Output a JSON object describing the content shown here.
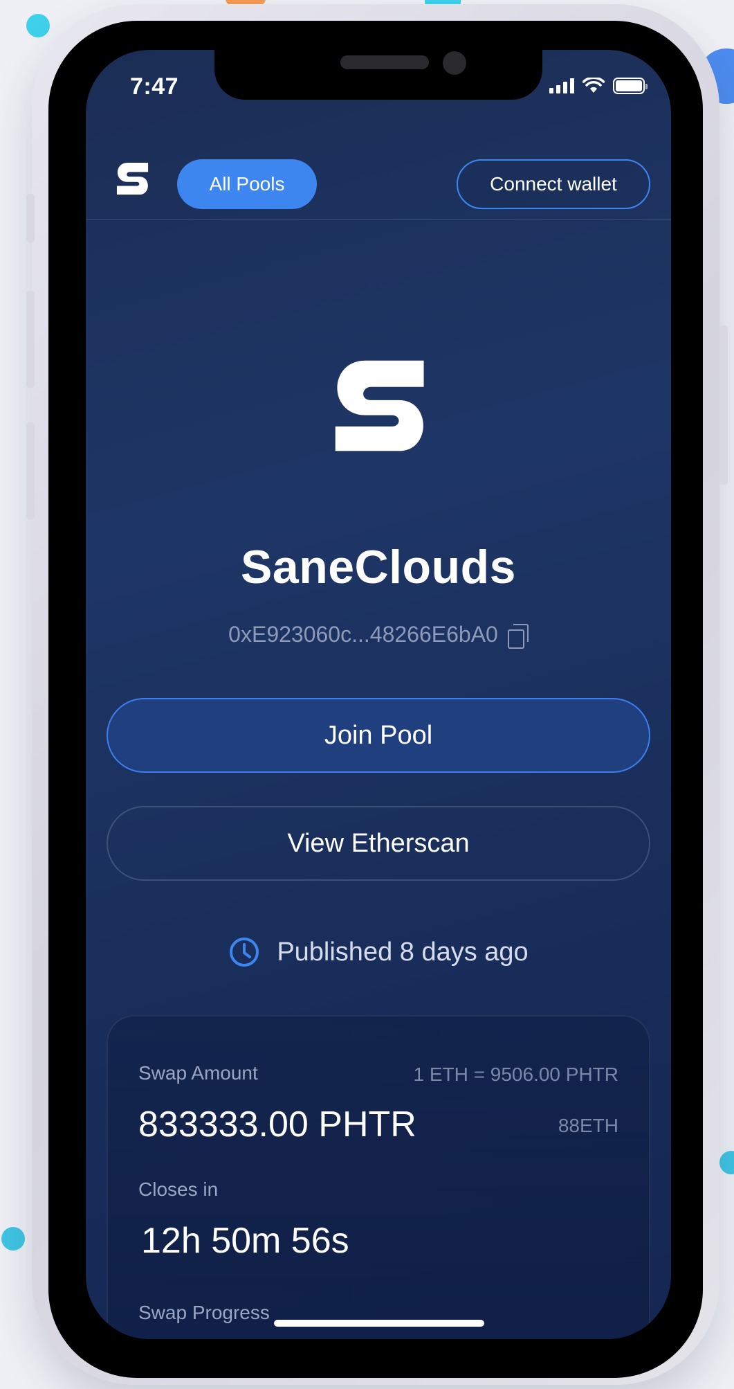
{
  "status_bar": {
    "time": "7:47"
  },
  "header": {
    "all_pools_label": "All Pools",
    "connect_wallet_label": "Connect wallet"
  },
  "pool": {
    "name": "SaneClouds",
    "address": "0xE923060c...48266E6bA0",
    "join_label": "Join Pool",
    "etherscan_label": "View Etherscan",
    "published": "Published 8 days ago"
  },
  "card": {
    "swap_amount_label": "Swap Amount",
    "rate": "1 ETH = 9506.00 PHTR",
    "amount": "833333.00 PHTR",
    "eth_amount": "88ETH",
    "closes_label": "Closes in",
    "closes_value": "12h 50m 56s",
    "progress_label": "Swap Progress"
  },
  "colors": {
    "accent": "#3d86f0",
    "background": "#1e3666",
    "muted_text": "#8e9ab8"
  },
  "icons": [
    "sane-logo-icon",
    "copy-icon",
    "clock-icon",
    "signal-icon",
    "wifi-icon",
    "battery-icon"
  ]
}
